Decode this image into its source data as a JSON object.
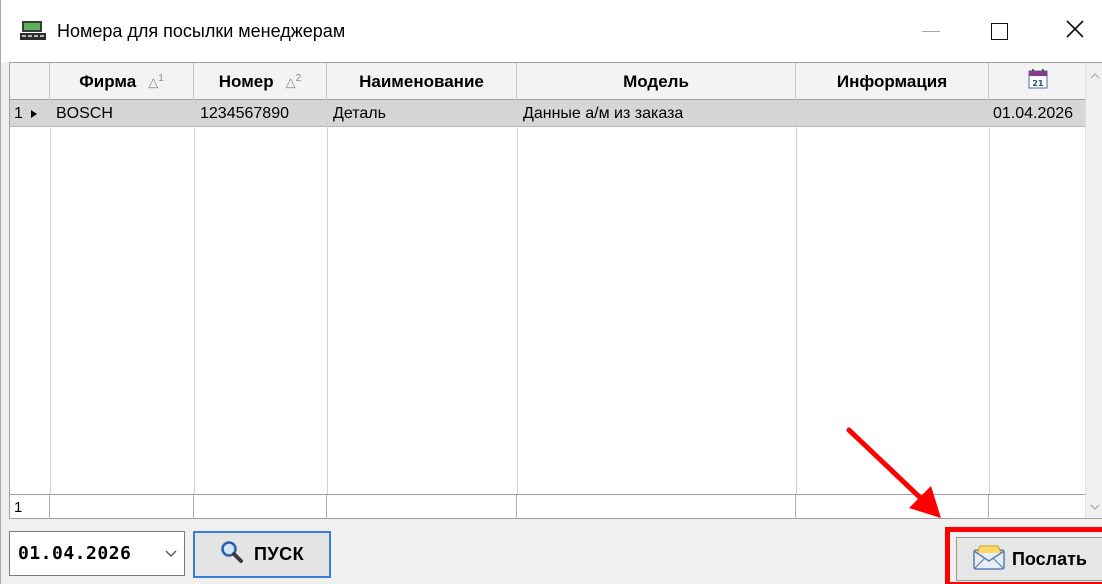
{
  "window": {
    "title": "Номера для посылки менеджерам"
  },
  "icons": {
    "app": "terminal-icon",
    "minimize": "minimize-icon",
    "maximize": "maximize-icon",
    "close": "close-icon",
    "calendar": "calendar-icon",
    "search": "magnifier-icon",
    "send": "envelope-icon"
  },
  "grid": {
    "columns": [
      {
        "label": "Фирма",
        "sort": "1"
      },
      {
        "label": "Номер",
        "sort": "2"
      },
      {
        "label": "Наименование",
        "sort": ""
      },
      {
        "label": "Модель",
        "sort": ""
      },
      {
        "label": "Информация",
        "sort": ""
      },
      {
        "label": "",
        "sort": ""
      }
    ],
    "calendar_day": "21",
    "rows": [
      {
        "index": "1",
        "firma": "BOSCH",
        "nomer": "1234567890",
        "naimenovanie": "Деталь",
        "model": "Данные а/м из заказа",
        "informaciya": "",
        "date": "01.04.2026"
      }
    ],
    "footer_count": "1"
  },
  "toolbar": {
    "date_value": "01.04.2026",
    "start_label": "ПУСК",
    "send_label": "Послать"
  },
  "annotation": {
    "color": "#ff0000"
  }
}
